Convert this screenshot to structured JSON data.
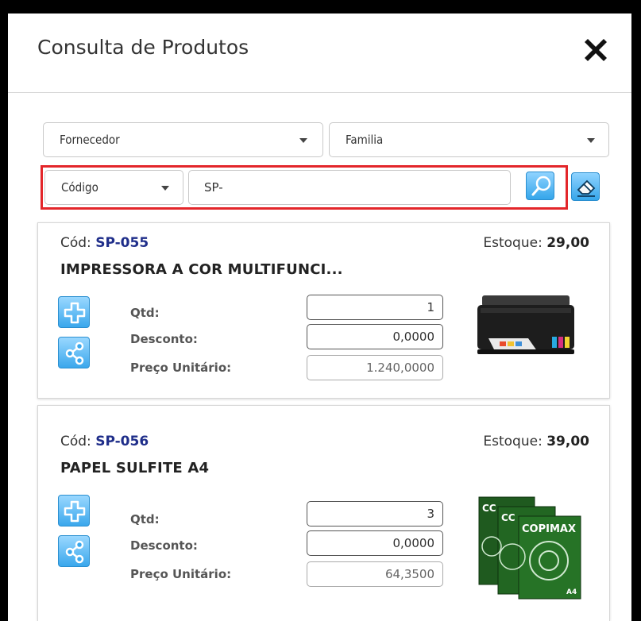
{
  "modal": {
    "title": "Consulta de Produtos",
    "close_icon": "close-x-icon"
  },
  "filters": {
    "fornecedor": "Fornecedor",
    "familia": "Familia",
    "search_field": "Código",
    "search_value": "SP-",
    "search_icon": "magnifier-icon",
    "clear_icon": "eraser-icon"
  },
  "products": [
    {
      "cod_label": "Cód:",
      "cod": "SP-055",
      "estoque_label": "Estoque:",
      "estoque": "29,00",
      "name": "IMPRESSORA A COR MULTIFUNCI...",
      "qtd_label": "Qtd:",
      "qtd": "1",
      "desconto_label": "Desconto:",
      "desconto": "0,0000",
      "preco_label": "Preço Unitário:",
      "preco": "1.240,0000",
      "image": "printer-image"
    },
    {
      "cod_label": "Cód:",
      "cod": "SP-056",
      "estoque_label": "Estoque:",
      "estoque": "39,00",
      "name": "PAPEL SULFITE A4",
      "qtd_label": "Qtd:",
      "qtd": "3",
      "desconto_label": "Desconto:",
      "desconto": "0,0000",
      "preco_label": "Preço Unitário:",
      "preco": "64,3500",
      "image": "paper-ream-image",
      "image_brand": "COPIMAX",
      "image_brand_short": "CC",
      "image_size": "A4"
    }
  ],
  "colors": {
    "code_blue": "#1f2e8a",
    "highlight_red": "#e3262a",
    "button_blue": "#35a6ea"
  }
}
